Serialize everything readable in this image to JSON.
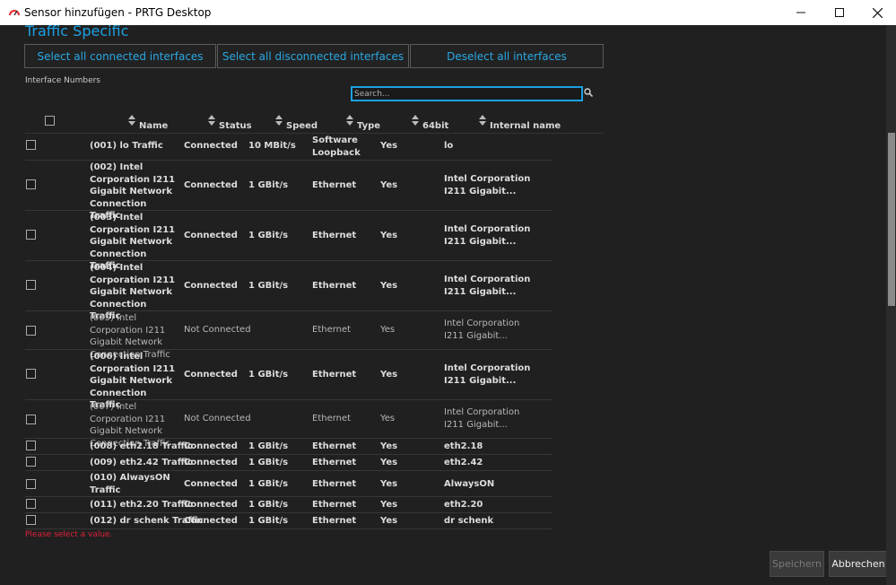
{
  "window": {
    "title": "Sensor hinzufügen - PRTG Desktop"
  },
  "section": {
    "title": "Traffic Specific"
  },
  "buttons": {
    "select_connected": "Select all connected interfaces",
    "select_disconnected": "Select all disconnected interfaces",
    "deselect_all": "Deselect all interfaces"
  },
  "interface_numbers_label": "Interface Numbers",
  "search": {
    "placeholder": "Search...",
    "value": ""
  },
  "columns": [
    "Name",
    "Status",
    "Speed",
    "Type",
    "64bit",
    "Internal name"
  ],
  "rows": [
    {
      "name": "(001) lo Traffic",
      "status": "Connected",
      "speed": "10 MBit/s",
      "type": "Software Loopback",
      "bit64": "Yes",
      "internal": "lo"
    },
    {
      "name": "(002) Intel Corporation I211 Gigabit Network Connection Traffic",
      "status": "Connected",
      "speed": "1 GBit/s",
      "type": "Ethernet",
      "bit64": "Yes",
      "internal": "Intel Corporation I211 Gigabit..."
    },
    {
      "name": "(003) Intel Corporation I211 Gigabit Network Connection Traffic",
      "status": "Connected",
      "speed": "1 GBit/s",
      "type": "Ethernet",
      "bit64": "Yes",
      "internal": "Intel Corporation I211 Gigabit..."
    },
    {
      "name": "(004) Intel Corporation I211 Gigabit Network Connection Traffic",
      "status": "Connected",
      "speed": "1 GBit/s",
      "type": "Ethernet",
      "bit64": "Yes",
      "internal": "Intel Corporation I211 Gigabit..."
    },
    {
      "name": "(005) Intel Corporation I211 Gigabit Network Connection Traffic",
      "status": "Not Connected",
      "speed": "",
      "type": "Ethernet",
      "bit64": "Yes",
      "internal": "Intel Corporation I211 Gigabit..."
    },
    {
      "name": "(006) Intel Corporation I211 Gigabit Network Connection Traffic",
      "status": "Connected",
      "speed": "1 GBit/s",
      "type": "Ethernet",
      "bit64": "Yes",
      "internal": "Intel Corporation I211 Gigabit..."
    },
    {
      "name": "(007) Intel Corporation I211 Gigabit Network Connection Traffic",
      "status": "Not Connected",
      "speed": "",
      "type": "Ethernet",
      "bit64": "Yes",
      "internal": "Intel Corporation I211 Gigabit..."
    },
    {
      "name": "(008) eth2.18 Traffic",
      "status": "Connected",
      "speed": "1 GBit/s",
      "type": "Ethernet",
      "bit64": "Yes",
      "internal": "eth2.18"
    },
    {
      "name": "(009) eth2.42 Traffic",
      "status": "Connected",
      "speed": "1 GBit/s",
      "type": "Ethernet",
      "bit64": "Yes",
      "internal": "eth2.42"
    },
    {
      "name": "(010) AlwaysON Traffic",
      "status": "Connected",
      "speed": "1 GBit/s",
      "type": "Ethernet",
      "bit64": "Yes",
      "internal": "AlwaysON"
    },
    {
      "name": "(011) eth2.20 Traffic",
      "status": "Connected",
      "speed": "1 GBit/s",
      "type": "Ethernet",
      "bit64": "Yes",
      "internal": "eth2.20"
    },
    {
      "name": "(012) dr schenk Traffic",
      "status": "Connected",
      "speed": "1 GBit/s",
      "type": "Ethernet",
      "bit64": "Yes",
      "internal": "dr schenk"
    }
  ],
  "validation_error": "Please select a value.",
  "footer": {
    "save": "Speichern",
    "cancel": "Abbrechen"
  },
  "colors": {
    "accent": "#1ba1e2",
    "error": "#e0203a",
    "background": "#202020"
  }
}
